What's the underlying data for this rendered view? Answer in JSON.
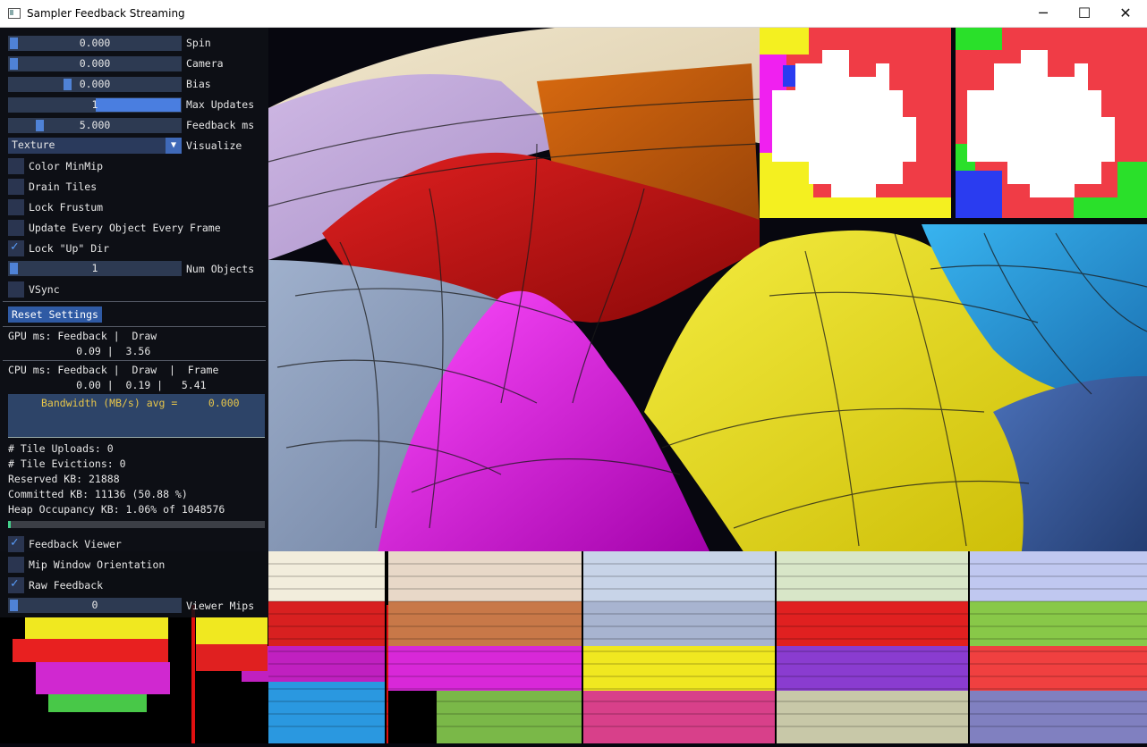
{
  "window": {
    "title": "Sampler Feedback Streaming",
    "controls": {
      "minimize": "─",
      "maximize": "☐",
      "close": "✕"
    }
  },
  "panel": {
    "sliders": [
      {
        "label": "Spin",
        "value": "0.000",
        "level": 0.0
      },
      {
        "label": "Camera",
        "value": "0.000",
        "level": 0.0
      },
      {
        "label": "Bias",
        "value": "0.000",
        "level": 0.35
      },
      {
        "label": "Max Updates",
        "value": "1",
        "level": 0.5
      },
      {
        "label": "Feedback ms",
        "value": "5.000",
        "level": 0.17
      }
    ],
    "visualize": {
      "value": "Texture",
      "label": "Visualize"
    },
    "checkboxes": [
      {
        "label": "Color MinMip",
        "checked": false
      },
      {
        "label": "Drain Tiles",
        "checked": false
      },
      {
        "label": "Lock Frustum",
        "checked": false
      },
      {
        "label": "Update Every Object Every Frame",
        "checked": false
      },
      {
        "label": "Lock \"Up\" Dir",
        "checked": true
      }
    ],
    "num_objects": {
      "label": "Num Objects",
      "value": "1"
    },
    "vsync": {
      "label": "VSync",
      "checked": false
    },
    "reset_button": "Reset Settings",
    "gpu_header": "GPU ms: Feedback |  Draw",
    "gpu_values": "           0.09 |  3.56",
    "cpu_header": "CPU ms: Feedback |  Draw  |  Frame",
    "cpu_values": "           0.00 |  0.19 |   5.41",
    "bandwidth": "Bandwidth (MB/s) avg =     0.000",
    "stats": [
      "# Tile Uploads: 0",
      "# Tile Evictions: 0",
      "Reserved KB: 21888",
      "Committed KB: 11136 (50.88 %)",
      "Heap Occupancy KB: 1.06% of 1048576"
    ],
    "heap_fraction": 0.0106,
    "lower_checkboxes": [
      {
        "label": "Feedback Viewer",
        "checked": true
      },
      {
        "label": "Mip Window Orientation",
        "checked": false
      },
      {
        "label": "Raw Feedback",
        "checked": true
      }
    ],
    "viewer_mips": {
      "label": "Viewer Mips",
      "value": "0"
    }
  },
  "colors": {
    "panel_bg": "#0e1016",
    "accent": "#4a7ee0",
    "warning_text": "#e8c64a",
    "terrain_yellow": "#e8de14",
    "terrain_magenta": "#d414d8",
    "terrain_red": "#c41010",
    "terrain_blue": "#1e9ad8"
  }
}
